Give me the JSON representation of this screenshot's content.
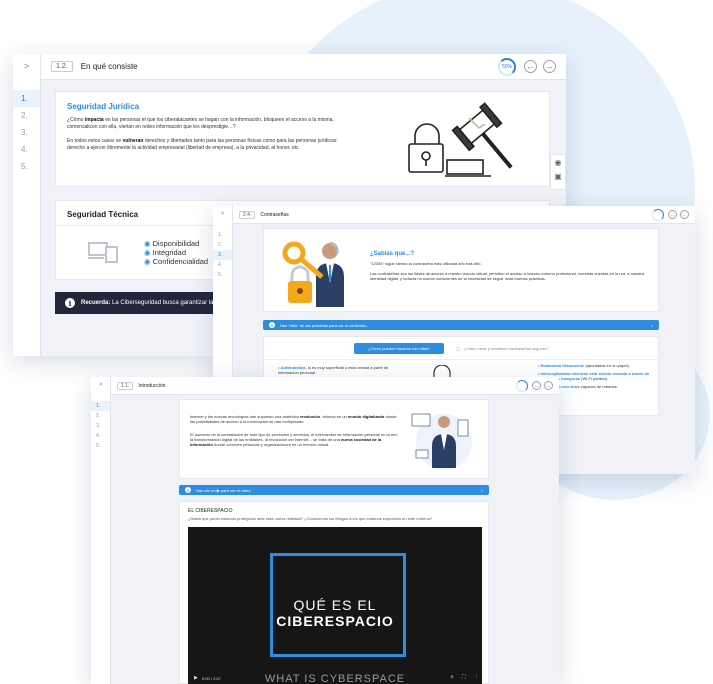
{
  "colors": {
    "accent": "#2e8de0",
    "dark_banner": "#23263a",
    "blob": "#e6f1fb",
    "background": "#f1f2f8"
  },
  "win1": {
    "header_code": "1.2.",
    "header_title": "En qué consiste",
    "progress_label": "50%",
    "nav_items": [
      "1.",
      "2.",
      "3.",
      "4.",
      "5."
    ],
    "juridica": {
      "title": "Seguridad Jurídica",
      "p1_a": "¿Cómo ",
      "p1_b": "impacta",
      "p1_c": " en las personas el que los ciberatacantes se hagan con la información, bloqueen el acceso a la misma, comercialicen con ella, viertan en redes información que les desprestigie…?",
      "p2_a": "En todos estos casos se ",
      "p2_b": "vulneran",
      "p2_c": " derechos y libertades tanto para las personas físicas como para las personas jurídicas: derecho a ejercer libremente la actividad empresarial (libertad de empresa), a la privacidad, al honor, etc."
    },
    "tecnica": {
      "title": "Seguridad Técnica",
      "items": [
        "Disponibilidad",
        "Integridad",
        "Confidencialidad"
      ]
    },
    "recuerda_label": "Recuerda:",
    "recuerda_text": " La Ciberseguridad busca garantizar la se"
  },
  "win2": {
    "header_code": "2.4.",
    "header_title": "Contraseñas",
    "nav_items": [
      "1.",
      "2.",
      "3.",
      "4.",
      "5."
    ],
    "sabias": {
      "title": "¿Sabías que...?",
      "line1": "\"12345\" sigue siendo la contraseña más utilizada año tras año.",
      "line2": "Las contraseñas son las llaves de acceso a nuestro mundo virtual; permiten el acceso a nuestro entorno profesional, nuestras cuentas en la red, a nuestra identidad digital, y todavía no somos conscientes de la necesidad de seguir unas buenas prácticas."
    },
    "banner_text": "Haz \"click\" en las pestañas para ver el contenido.",
    "tab_active": "¿Cómo pueden hacerse con ellas?",
    "tab_inactive": "¿Cómo crear y mantener contraseñas seguras?",
    "left_bullets": [
      {
        "b": "Adivinándola",
        "t": ", si es muy superficial o está creada a partir de información personal."
      }
    ],
    "right_bullets": [
      {
        "b": "Robándola físicamente",
        "t": " (apuntadas en un papel)."
      },
      {
        "b": "Interceptándola mientras está siendo enviada a través de conexiones inseguras",
        "t": " (Wi-Fi pública)."
      },
      {
        "b": "Infectando con virus",
        "t": " capaces de robarlas."
      }
    ]
  },
  "win3": {
    "header_code": "1.1.",
    "header_title": "Introducción",
    "nav_items": [
      "1.",
      "2.",
      "3.",
      "4.",
      "5."
    ],
    "intro_p1_a": "Internet y las nuevas tecnologías han supuesto una auténtica ",
    "intro_p1_b": "revolución",
    "intro_p1_c": ", vivimos en un ",
    "intro_p1_d": "mundo digitalizado",
    "intro_p1_e": " donde las posibilidades de acceso a la información se han multiplicado.",
    "intro_p2_a": "El aumento de la contratación de todo tipo de productos y servicios, el intercambio de información personal en la red, la transformación digital de las entidades, la revolución del internet… se trata de una ",
    "intro_p2_b": "nueva sociedad de la información",
    "intro_p2_c": " donde conviven personas y organizaciones en un entorno virtual.",
    "banner_a": "Haz clic en ",
    "banner_b": " para ver el vídeo",
    "section_title": "EL CIBERESPACIO",
    "section_sub": "¿Hasta qué punto estamos protegidos ante esta nueva realidad? ¿Conocemos los riesgos a los que estamos expuestos en este entorno?",
    "video_line1": "QUÉ ES EL",
    "video_line2": "CIBERESPACIO",
    "video_sub": "WHAT IS CYBERSPACE",
    "video_time": "0:00 / 2:07"
  }
}
